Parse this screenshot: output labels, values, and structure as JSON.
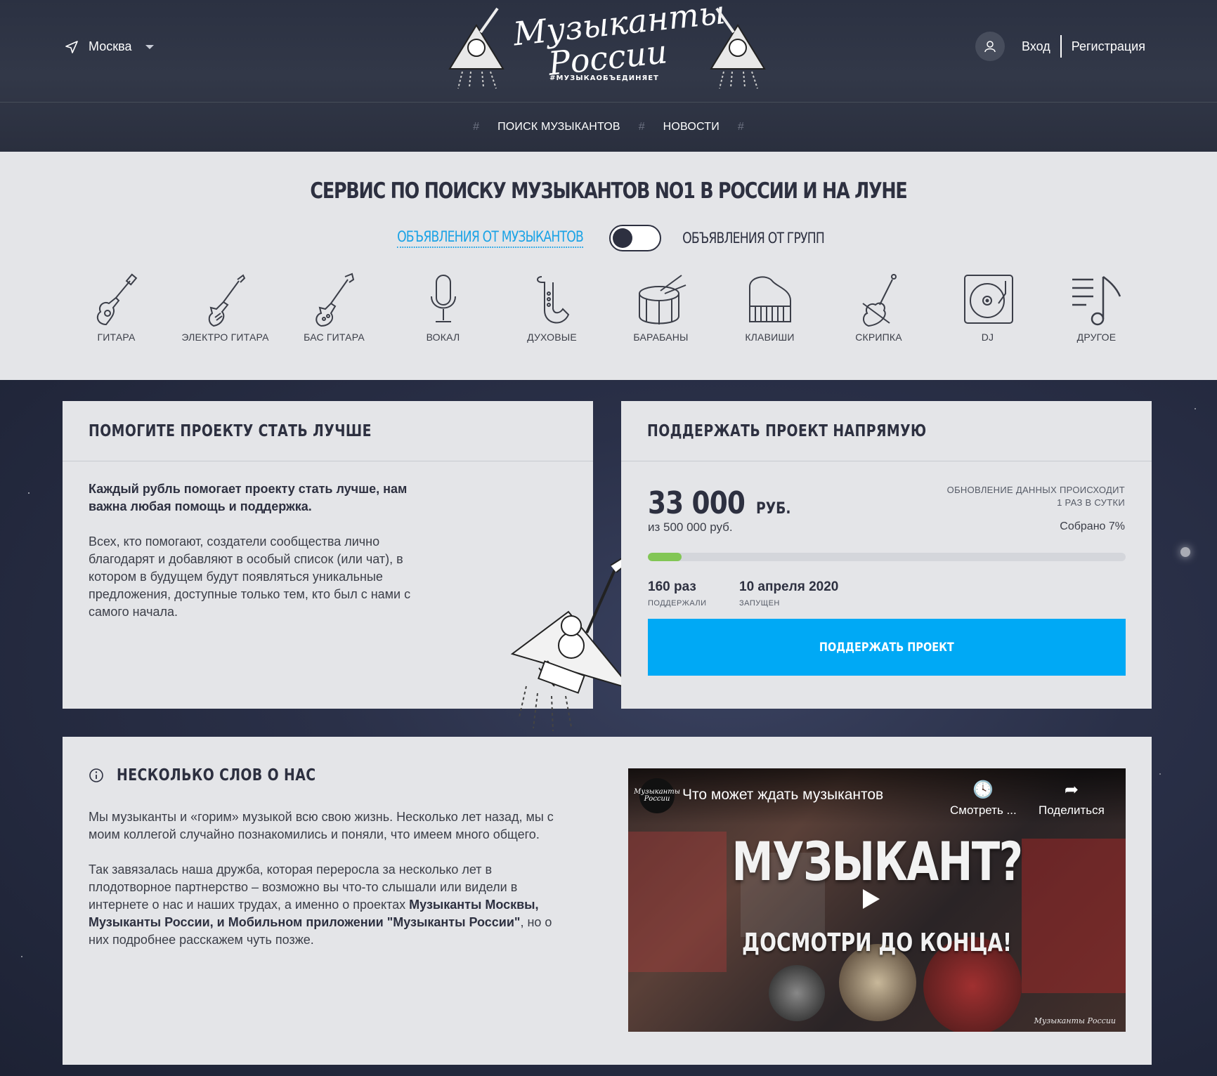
{
  "header": {
    "city": "Москва",
    "logo": {
      "line1": "Музыканты",
      "line2": "России",
      "tag": "#МУЗЫКАОБЪЕДИНЯЕТ"
    },
    "auth": {
      "login": "Вход",
      "register": "Регистрация"
    },
    "nav": [
      {
        "label": "ПОИСК МУЗЫКАНТОВ"
      },
      {
        "label": "НОВОСТИ"
      }
    ],
    "hash": "#"
  },
  "hero": {
    "title": "СЕРВИС ПО ПОИСКУ МУЗЫКАНТОВ NO1 В РОССИИ И НА ЛУНЕ",
    "toggle_left": "ОБЪЯВЛЕНИЯ ОТ МУЗЫКАНТОВ",
    "toggle_right": "ОБЪЯВЛЕНИЯ ОТ ГРУПП",
    "categories": [
      {
        "label": "ГИТАРА",
        "icon": "acoustic-guitar-icon"
      },
      {
        "label": "ЭЛЕКТРО ГИТАРА",
        "icon": "electric-guitar-icon"
      },
      {
        "label": "БАС ГИТАРА",
        "icon": "bass-guitar-icon"
      },
      {
        "label": "ВОКАЛ",
        "icon": "microphone-icon"
      },
      {
        "label": "ДУХОВЫЕ",
        "icon": "saxophone-icon"
      },
      {
        "label": "БАРАБАНЫ",
        "icon": "drum-icon"
      },
      {
        "label": "КЛАВИШИ",
        "icon": "piano-icon"
      },
      {
        "label": "СКРИПКА",
        "icon": "violin-icon"
      },
      {
        "label": "DJ",
        "icon": "turntable-icon"
      },
      {
        "label": "ДРУГОЕ",
        "icon": "music-note-icon"
      }
    ]
  },
  "help_card": {
    "title": "ПОМОГИТЕ ПРОЕКТУ СТАТЬ ЛУЧШЕ",
    "lead": "Каждый рубль помогает проекту стать лучше, нам важна любая помощь и поддержка.",
    "text": "Всех, кто помогают, создатели сообщества лично благодарят и добавляют в особый список (или чат), в котором в будущем будут появляться уникальные предложения, доступные только тем, кто был с нами с самого начала."
  },
  "support_card": {
    "title": "ПОДДЕРЖАТЬ ПРОЕКТ НАПРЯМУЮ",
    "amount": "33 000",
    "currency": "РУБ.",
    "update_line1": "ОБНОВЛЕНИЕ ДАННЫХ ПРОИСХОДИТ",
    "update_line2": "1 РАЗ В СУТКИ",
    "goal": "из 500 000 руб.",
    "collected": "Собрано 7%",
    "progress_percent": 7,
    "supporters_value": "160 раз",
    "supporters_label": "ПОДДЕРЖАЛИ",
    "launched_value": "10 апреля 2020",
    "launched_label": "ЗАПУЩЕН",
    "button": "ПОДДЕРЖАТЬ ПРОЕКТ"
  },
  "about": {
    "title": "НЕСКОЛЬКО СЛОВ О НАС",
    "p1": "Мы музыканты и «горим» музыкой всю свою жизнь. Несколько лет назад, мы с моим коллегой случайно познакомились и поняли, что имеем много общего.",
    "p2_start": "Так завязалась наша дружба, которая переросла за несколько лет в плодотворное партнерство – возможно вы что-то слышали или видели в интернете о нас и наших трудах, а именно о проектах ",
    "p2_bold": "Музыканты Москвы, Музыканты России, и Мобильном приложении \"Музыканты России\"",
    "p2_end": ", но о них подробнее расскажем чуть позже."
  },
  "video": {
    "title": "Что может ждать музыкантов",
    "watch_later": "Смотреть ...",
    "share": "Поделиться",
    "headline": "МУЗЫКАНТ?",
    "subline": "ДОСМОТРИ ДО КОНЦА!",
    "channel_logo": "Музыканты России"
  },
  "colors": {
    "accent_blue": "#00a9f5",
    "link_blue": "#1ba3e6",
    "progress_green": "#82c655",
    "dark": "#2d3040"
  }
}
